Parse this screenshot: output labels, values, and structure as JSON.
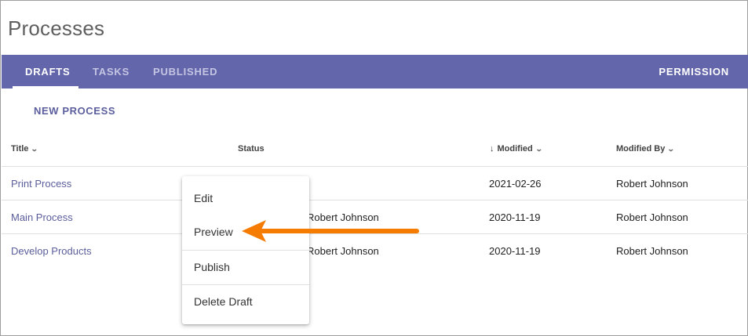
{
  "page": {
    "title": "Processes"
  },
  "tabs": {
    "drafts": "DRAFTS",
    "tasks": "TASKS",
    "published": "PUBLISHED",
    "permission": "PERMISSION"
  },
  "toolbar": {
    "new_process": "NEW PROCESS"
  },
  "table": {
    "columns": {
      "title": "Title",
      "status": "Status",
      "modified": "Modified",
      "modified_by": "Modified By"
    },
    "rows": [
      {
        "title": "Print Process",
        "status": "",
        "modified": "2021-02-26",
        "modified_by": "Robert Johnson"
      },
      {
        "title": "Main Process",
        "status": "Robert Johnson",
        "modified": "2020-11-19",
        "modified_by": "Robert Johnson"
      },
      {
        "title": "Develop Products",
        "status": "Robert Johnson",
        "modified": "2020-11-19",
        "modified_by": "Robert Johnson"
      }
    ]
  },
  "context_menu": {
    "items": [
      "Edit",
      "Preview",
      "Publish",
      "Delete Draft"
    ]
  },
  "colors": {
    "tab_bar": "#6366aa",
    "link": "#5b5e9c",
    "annotation_arrow": "#f57c00"
  },
  "icons": {
    "sort_chevron": "chevron-down-icon",
    "sort_direction": "arrow-down-icon"
  }
}
